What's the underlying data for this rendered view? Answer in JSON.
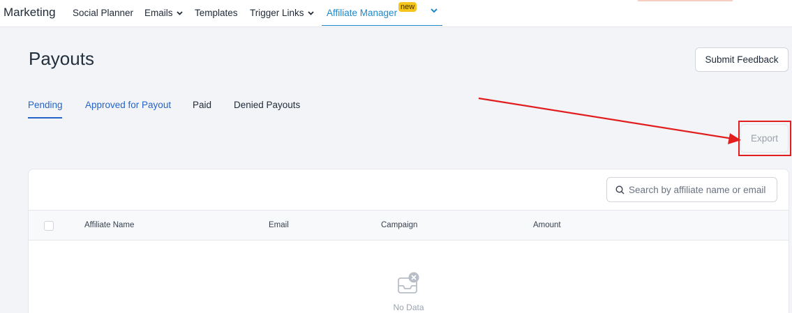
{
  "nav": {
    "brand": "Marketing",
    "items": [
      {
        "label": "Social Planner"
      },
      {
        "label": "Emails"
      },
      {
        "label": "Templates"
      },
      {
        "label": "Trigger Links"
      },
      {
        "label": "Affiliate Manager"
      }
    ],
    "new_badge": "new"
  },
  "page": {
    "title": "Payouts",
    "feedback_label": "Submit Feedback"
  },
  "tabs": [
    {
      "label": "Pending"
    },
    {
      "label": "Approved for Payout"
    },
    {
      "label": "Paid"
    },
    {
      "label": "Denied Payouts"
    }
  ],
  "toolbar": {
    "export_label": "Export"
  },
  "table": {
    "search_placeholder": "Search by affiliate name or email",
    "columns": [
      "Affiliate Name",
      "Email",
      "Campaign",
      "Amount"
    ],
    "empty_text": "No Data"
  },
  "colors": {
    "accent": "#1e88c9",
    "tab_active": "#2563c9",
    "annotation": "#e11d1d",
    "badge": "#f5c51b"
  }
}
